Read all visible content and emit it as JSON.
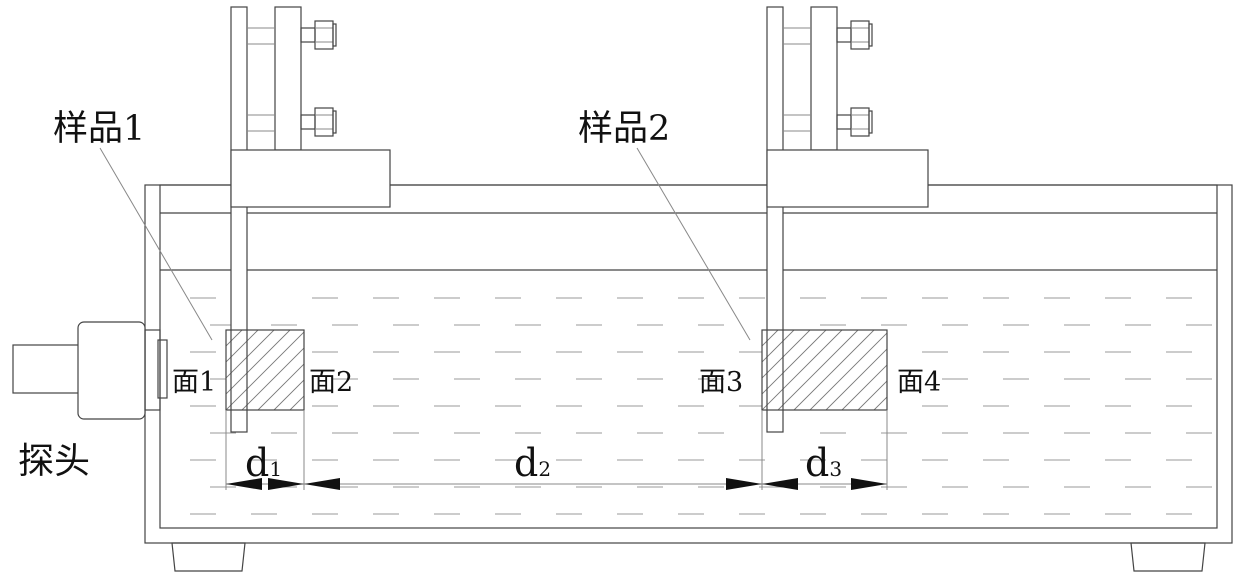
{
  "labels": {
    "sample1": "样品1",
    "sample2": "样品2",
    "face1": "面1",
    "face2": "面2",
    "face3": "面3",
    "face4": "面4",
    "probe": "探头",
    "d1": {
      "base": "d",
      "sub": "1"
    },
    "d2": {
      "base": "d",
      "sub": "2"
    },
    "d3": {
      "base": "d",
      "sub": "3"
    }
  },
  "colors": {
    "line": "#444444",
    "hatch": "#777777",
    "water_dash": "#999999",
    "text": "#111111"
  }
}
